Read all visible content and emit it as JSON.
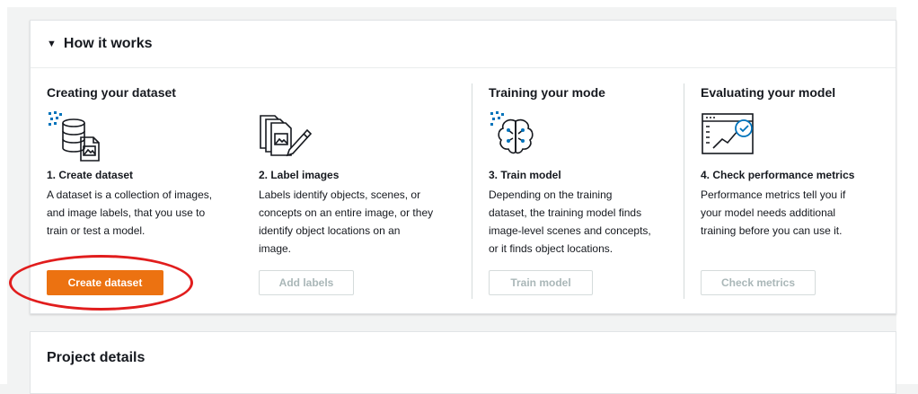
{
  "how_it_works": {
    "title": "How it works",
    "columns": [
      {
        "heading": "Creating your dataset",
        "steps": [
          {
            "title": "1. Create dataset",
            "lines": [
              "A dataset is a collection of images,",
              "and image labels, that you use to",
              "train or test a model."
            ],
            "button": "Create dataset",
            "icon": "dataset-icon"
          },
          {
            "title": "2. Label images",
            "lines": [
              "Labels identify objects, scenes, or",
              "concepts on an entire image, or they",
              "identify object locations on an",
              "image."
            ],
            "button": "Add labels",
            "icon": "label-images-icon"
          }
        ]
      },
      {
        "heading": "Training your mode",
        "steps": [
          {
            "title": "3. Train model",
            "lines": [
              "Depending on the training",
              "dataset, the training model finds",
              "image-level scenes and concepts,",
              "or it finds object locations."
            ],
            "button": "Train model",
            "icon": "brain-icon"
          }
        ]
      },
      {
        "heading": "Evaluating your model",
        "steps": [
          {
            "title": "4. Check performance metrics",
            "lines": [
              "Performance metrics tell you if",
              "your model needs additional",
              "training before you can use it."
            ],
            "button": "Check metrics",
            "icon": "metrics-chart-icon"
          }
        ]
      }
    ]
  },
  "project_details": {
    "title": "Project details"
  },
  "colors": {
    "primary": "#ec7211",
    "highlight": "#e11d1d",
    "icon_blue": "#0073bb"
  }
}
